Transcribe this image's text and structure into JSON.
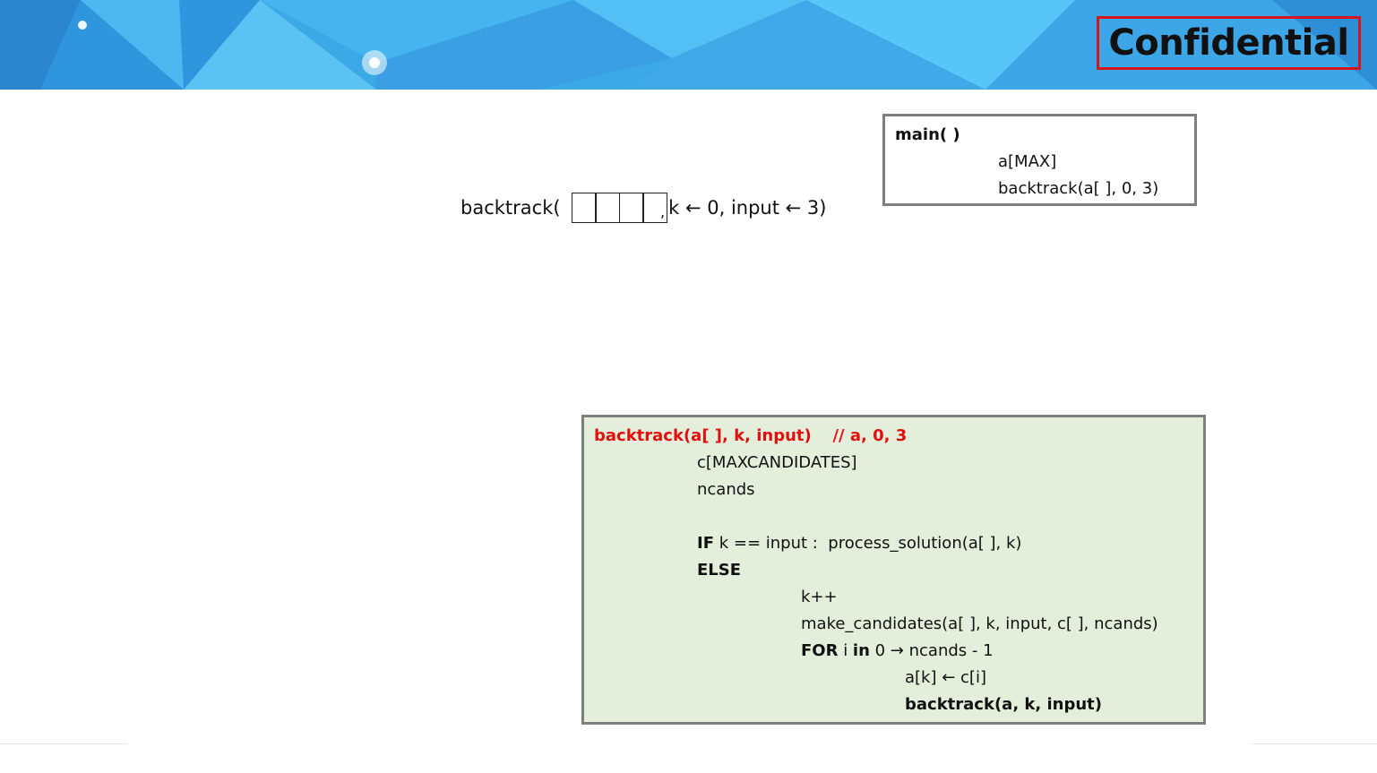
{
  "header": {
    "badge": "Confidential"
  },
  "call": {
    "prefix": "backtrack(",
    "comma": ",",
    "suffix": "k  ←  0,  input  ←  3)"
  },
  "main_box": {
    "title": "main( )",
    "line1": "a[MAX]",
    "line2": "backtrack(a[ ], 0, 3)"
  },
  "code": {
    "signature": "backtrack(a[ ], k, input)",
    "comment": "// a, 0, 3",
    "decl1": "c[MAXCANDIDATES]",
    "decl2": "ncands",
    "if_kw": "IF",
    "if_rest": " k == input :  process_solution(a[ ], k)",
    "else_kw": "ELSE",
    "inc": "k++",
    "make": "make_candidates(a[ ], k, input, c[ ], ncands)",
    "for_kw": "FOR",
    "for_mid1": " i ",
    "for_in": "in",
    "for_rest": " 0 → ncands - 1",
    "assign": "a[k] ← c[i]",
    "recurse": "backtrack(a, k, input)"
  },
  "colors": {
    "banner": "#3aa9e6",
    "badge_border": "#d9141c",
    "code_bg": "#e3efda",
    "signature": "#e01010"
  }
}
